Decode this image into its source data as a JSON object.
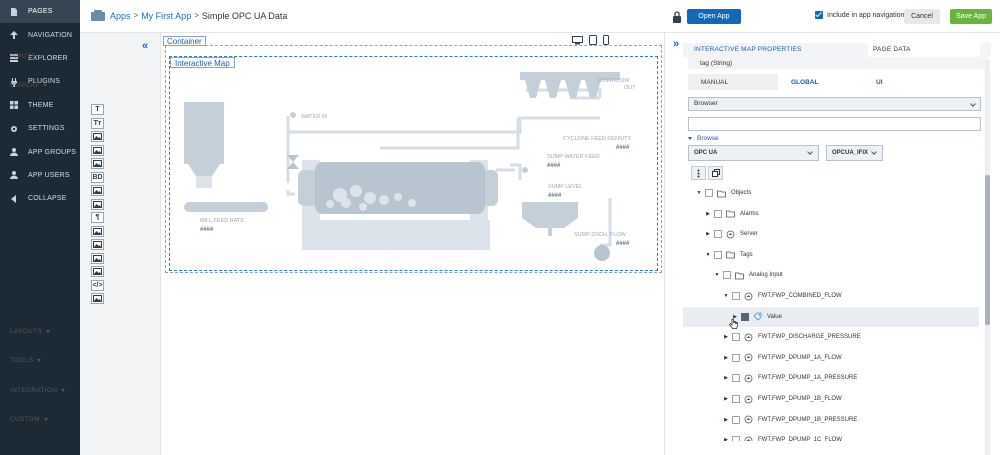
{
  "nav": {
    "items": [
      {
        "label": "PAGES",
        "icon": "page-icon",
        "active": true
      },
      {
        "label": "NAVIGATION",
        "icon": "navigation-icon"
      },
      {
        "label": "EXPLORER",
        "icon": "explorer-icon"
      },
      {
        "label": "PLUGINS",
        "icon": "plug-icon"
      },
      {
        "label": "THEME",
        "icon": "theme-icon"
      },
      {
        "label": "SETTINGS",
        "icon": "gear-icon"
      },
      {
        "label": "APP GROUPS",
        "icon": "group-icon"
      },
      {
        "label": "APP USERS",
        "icon": "user-icon"
      },
      {
        "label": "COLLAPSE",
        "icon": "collapse-icon"
      }
    ]
  },
  "header": {
    "crumb_apps": "Apps",
    "crumb_app": "My First App",
    "crumb_sep": ">",
    "page_title": "Simple OPC UA Data",
    "open_app": "Open App",
    "include_nav": "Include in app navigation",
    "cancel": "Cancel",
    "save_app": "Save App"
  },
  "palette": {
    "sections": [
      "INPUTS",
      "DISPLAY",
      "LAYOUTS",
      "TOOLS",
      "INTEGRATION",
      "CUSTOM"
    ],
    "collapse": "«",
    "tools": [
      "T",
      "Tт",
      "",
      "",
      "",
      "BD",
      "",
      "",
      "¶",
      "",
      "",
      "",
      "",
      "</>",
      ""
    ]
  },
  "canvas": {
    "container_label": "Container",
    "map_label": "Interactive Map",
    "map": {
      "water_in": "WATER IN",
      "overflow": "OVERFLOW",
      "out": "OUT",
      "cyclone_density": "CYCLONE FEED DENSITY",
      "sump_water_feed": "SUMP WATER FEED",
      "sump_level": "SUMP LEVEL",
      "mill_feed_rate": "MILL FEED RATE",
      "sump_dsch_flow": "SUMP DSCH. FLOW",
      "placeholder_value": "####"
    }
  },
  "right_panel": {
    "expand": "»",
    "tab_properties": "INTERACTIVE MAP PROPERTIES",
    "tab_page_data": "PAGE DATA",
    "tag_row": "tag (String)",
    "subtabs": [
      "MANUAL",
      "GLOBAL",
      "UI"
    ],
    "browser_select": "Browser",
    "browse_label": "Browse",
    "source_select": "OPC UA",
    "server_select": "OPCUA_IFIX",
    "tree": [
      {
        "label": "Objects",
        "indent": 0,
        "arrow": "▼",
        "icon": "folder-icon"
      },
      {
        "label": "Alarms",
        "indent": 1,
        "arrow": "▶",
        "icon": "folder-icon"
      },
      {
        "label": "Server",
        "indent": 1,
        "arrow": "▶",
        "icon": "object-icon"
      },
      {
        "label": "Tags",
        "indent": 1,
        "arrow": "▼",
        "icon": "folder-icon"
      },
      {
        "label": "Analog Input",
        "indent": 2,
        "arrow": "▼",
        "icon": "folder-icon"
      },
      {
        "label": "FWT.FWP_COMBINED_FLOW",
        "indent": 3,
        "arrow": "▼",
        "icon": "object-icon"
      },
      {
        "label": "Value",
        "indent": 4,
        "arrow": "▶",
        "icon": "tag-icon",
        "highlight": true
      },
      {
        "label": "FWT.FWP_DISCHARGE_PRESSURE",
        "indent": 3,
        "arrow": "▶",
        "icon": "object-icon"
      },
      {
        "label": "FWT.FWP_DPUMP_1A_FLOW",
        "indent": 3,
        "arrow": "▶",
        "icon": "object-icon"
      },
      {
        "label": "FWT.FWP_DPUMP_1A_PRESSURE",
        "indent": 3,
        "arrow": "▶",
        "icon": "object-icon"
      },
      {
        "label": "FWT.FWP_DPUMP_1B_FLOW",
        "indent": 3,
        "arrow": "▶",
        "icon": "object-icon"
      },
      {
        "label": "FWT.FWP_DPUMP_1B_PRESSURE",
        "indent": 3,
        "arrow": "▶",
        "icon": "object-icon"
      },
      {
        "label": "FWT.FWP_DPUMP_1C_FLOW",
        "indent": 3,
        "arrow": "▶",
        "icon": "object-icon"
      }
    ]
  },
  "colors": {
    "nav_bg": "#1c2a36",
    "accent_blue": "#1468b8",
    "save_green": "#6bb33e"
  }
}
